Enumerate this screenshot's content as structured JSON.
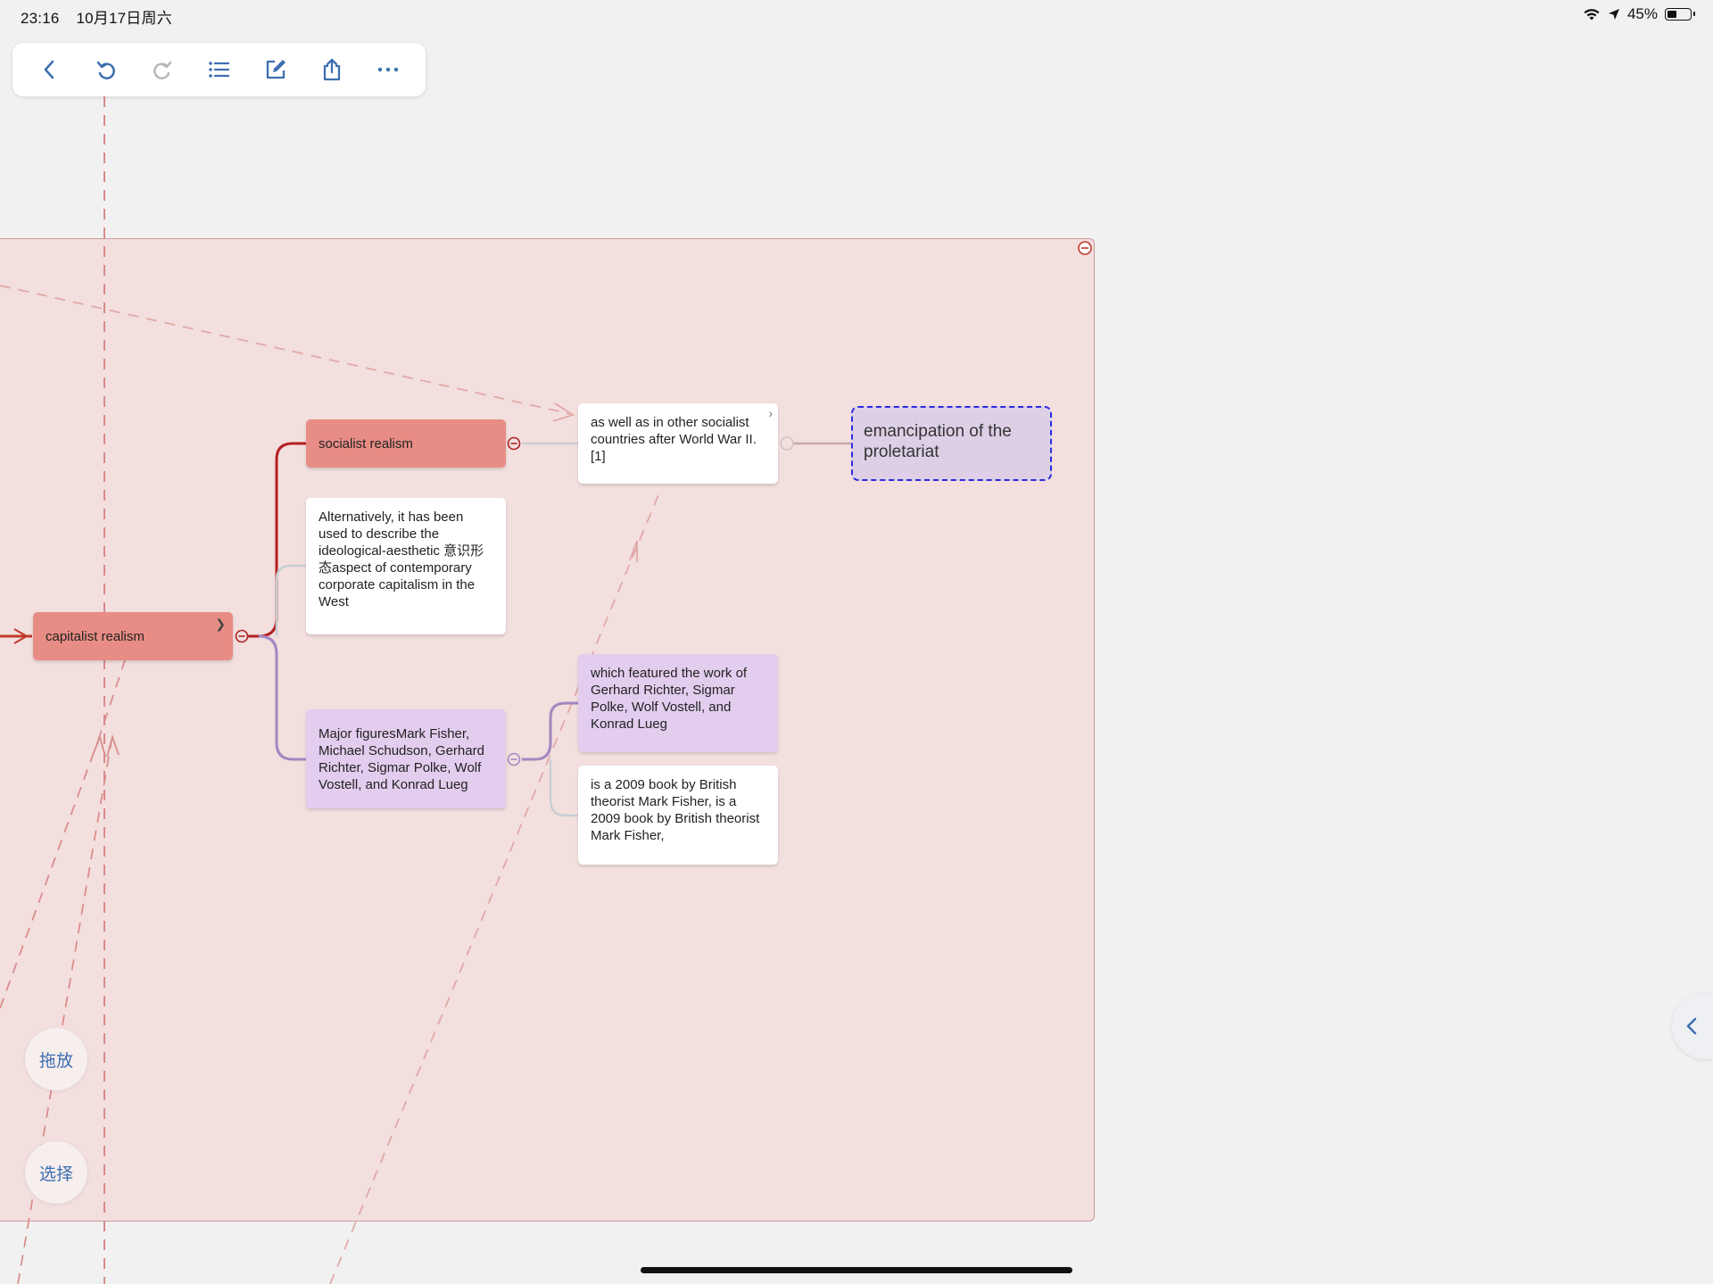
{
  "status_bar": {
    "time": "23:16",
    "date": "10月17日周六",
    "battery": "45%",
    "battery_level": 0.45
  },
  "toolbar": {
    "buttons": [
      {
        "name": "back-icon"
      },
      {
        "name": "undo-icon"
      },
      {
        "name": "redo-icon"
      },
      {
        "name": "outline-list-icon"
      },
      {
        "name": "edit-icon"
      },
      {
        "name": "share-icon"
      },
      {
        "name": "more-icon"
      }
    ]
  },
  "map": {
    "capitalist_realism": "capitalist realism",
    "socialist_realism": "socialist realism",
    "alternatively": "Alternatively, it has been used to describe the ideological-aesthetic 意识形态aspect of contemporary corporate capitalism in the West",
    "major_figures": "Major figuresMark Fisher, Michael Schudson, Gerhard Richter, Sigmar Polke, Wolf Vostell, and Konrad Lueg",
    "as_well_as": "as well as in other socialist countries after World War II.[1]",
    "which_featured": "which featured the work of Gerhard Richter, Sigmar Polke, Wolf Vostell, and Konrad Lueg",
    "book": "is a 2009 book by British theorist Mark Fisher, is a 2009 book by British theorist Mark Fisher,",
    "emancipation": "emancipation of the proletariat"
  },
  "side_buttons": {
    "drag": "拖放",
    "select": "选择"
  },
  "colors": {
    "accent": "#3d6fb0",
    "red_topic": "#e88d85",
    "purple_topic": "#e2cdee",
    "boundary": "#f2dfde"
  }
}
